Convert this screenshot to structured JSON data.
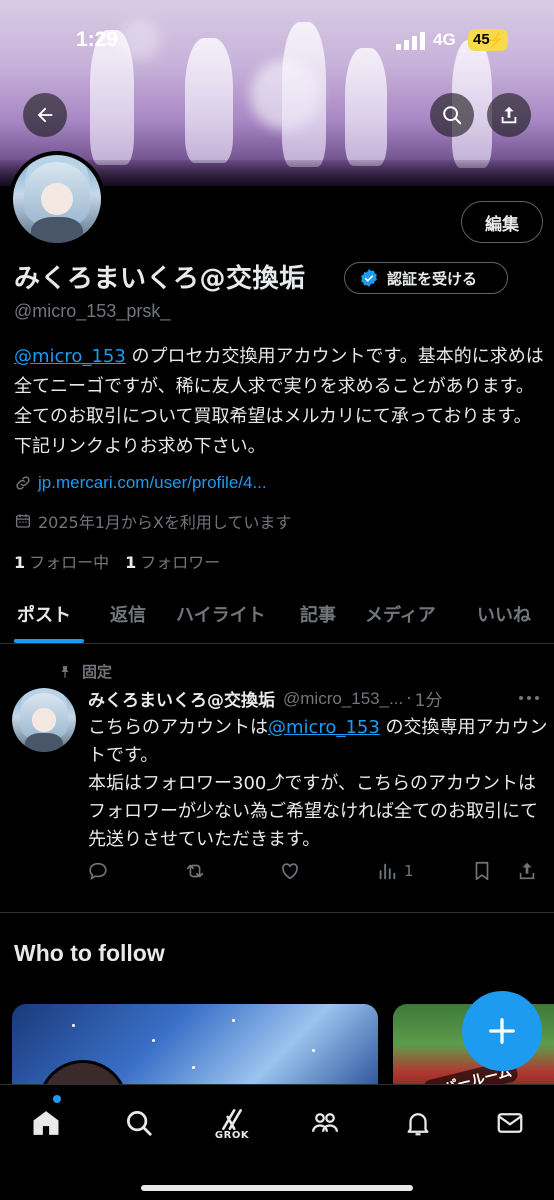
{
  "status_bar": {
    "time": "1:29",
    "network": "4G",
    "battery": "45"
  },
  "header": {
    "back_icon": "arrow-left-icon",
    "search_icon": "search-icon",
    "share_icon": "share-icon"
  },
  "profile": {
    "edit_label": "編集",
    "display_name": "みくろまいくろ@交換垢",
    "verify_label": "認証を受ける",
    "handle": "@micro_153_prsk_",
    "bio_mention": "@micro_153",
    "bio_text": " のプロセカ交換用アカウントです。基本的に求めは全てニーゴですが、稀に友人求で実りを求めることがあります。全てのお取引について買取希望はメルカリにて承っております。下記リンクよりお求め下さい。",
    "link": "jp.mercari.com/user/profile/4...",
    "joined": "2025年1月からXを利用しています",
    "following_count": "1",
    "following_label": "フォロー中",
    "followers_count": "1",
    "followers_label": "フォロワー"
  },
  "tabs": [
    {
      "label": "ポスト"
    },
    {
      "label": "返信"
    },
    {
      "label": "ハイライト"
    },
    {
      "label": "記事"
    },
    {
      "label": "メディア"
    },
    {
      "label": "いいね"
    }
  ],
  "pinned_tweet": {
    "pinned_label": "固定",
    "name": "みくろまいくろ@交換垢",
    "handle": "@micro_153_...",
    "dot": "·",
    "time": "1分",
    "text_before": "こちらのアカウントは",
    "mention": "@micro_153",
    "text_after": " の交換専用アカウントです。",
    "text_line2": "本垢はフォロワー300⤴︎ですが、こちらのアカウントはフォロワーが少ない為ご希望なければ全てのお取引にて先送りさせていただきます。",
    "views": "1"
  },
  "who_to_follow": {
    "title": "Who to follow",
    "card2_text": "ーパールーム"
  },
  "bottom_nav": {
    "grok_label": "GROK"
  },
  "colors": {
    "accent": "#1d9bf0",
    "muted": "#71767b",
    "text": "#e7e9ea",
    "border": "#2f3336",
    "battery": "#f7d94c"
  }
}
